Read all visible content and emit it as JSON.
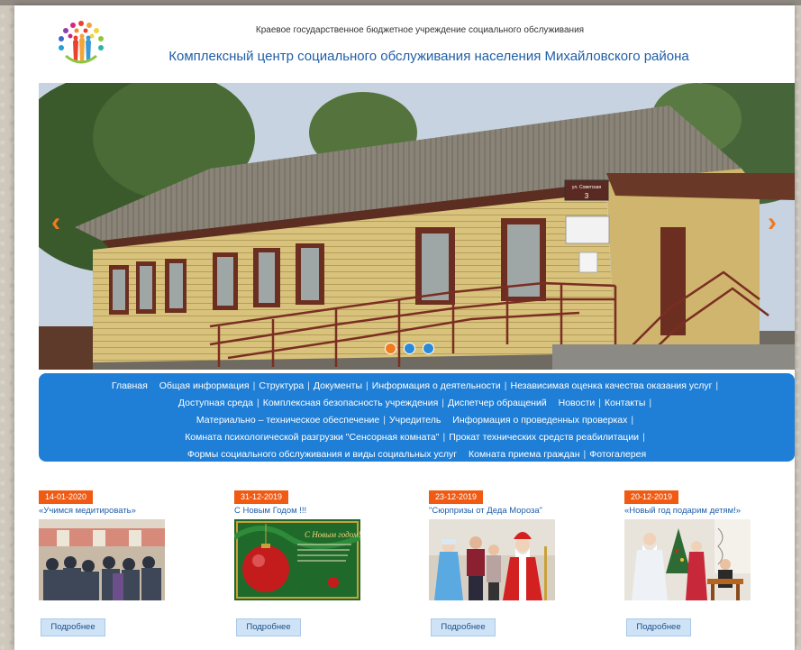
{
  "header": {
    "subtitle": "Краевое государственное бюджетное учреждение социального обслуживания",
    "title": "Комплексный центр социального обслуживания населения Михайловского района"
  },
  "slider": {
    "sign_street": "ул. Советская",
    "sign_number": "3",
    "slides_count": 3,
    "active_slide": 1
  },
  "nav": {
    "items": [
      "Главная",
      "Общая информация",
      "Структура",
      "Документы",
      "Информация о деятельности",
      "Независимая оценка качества оказания услуг",
      "Доступная среда",
      "Комплексная безопасность учреждения",
      "Диспетчер обращений",
      "Новости",
      "Контакты",
      "Материально – техническое обеспечение",
      "Учредитель",
      "Информация о проведенных проверках",
      "Комната психологической разгрузки \"Сенсорная комната\"",
      "Прокат технических средств реабилитации",
      "Формы социального обслуживания и виды социальных услуг",
      "Комната приема граждан",
      "Фотогалерея"
    ]
  },
  "news": [
    {
      "date": "14-01-2020",
      "title": "«Учимся медитировать»",
      "button": "Подробнее"
    },
    {
      "date": "31-12-2019",
      "title": "С Новым Годом !!!",
      "button": "Подробнее",
      "card_text": "С Новым годом!"
    },
    {
      "date": "23-12-2019",
      "title": "\"Сюрпризы от Деда Мороза\"",
      "button": "Подробнее"
    },
    {
      "date": "20-12-2019",
      "title": "«Новый год подарим детям!»",
      "button": "Подробнее"
    }
  ],
  "colors": {
    "accent_blue": "#1f7fd6",
    "title_blue": "#1f5fa8",
    "date_orange": "#f05a12",
    "arrow_orange": "#f07a1f"
  }
}
